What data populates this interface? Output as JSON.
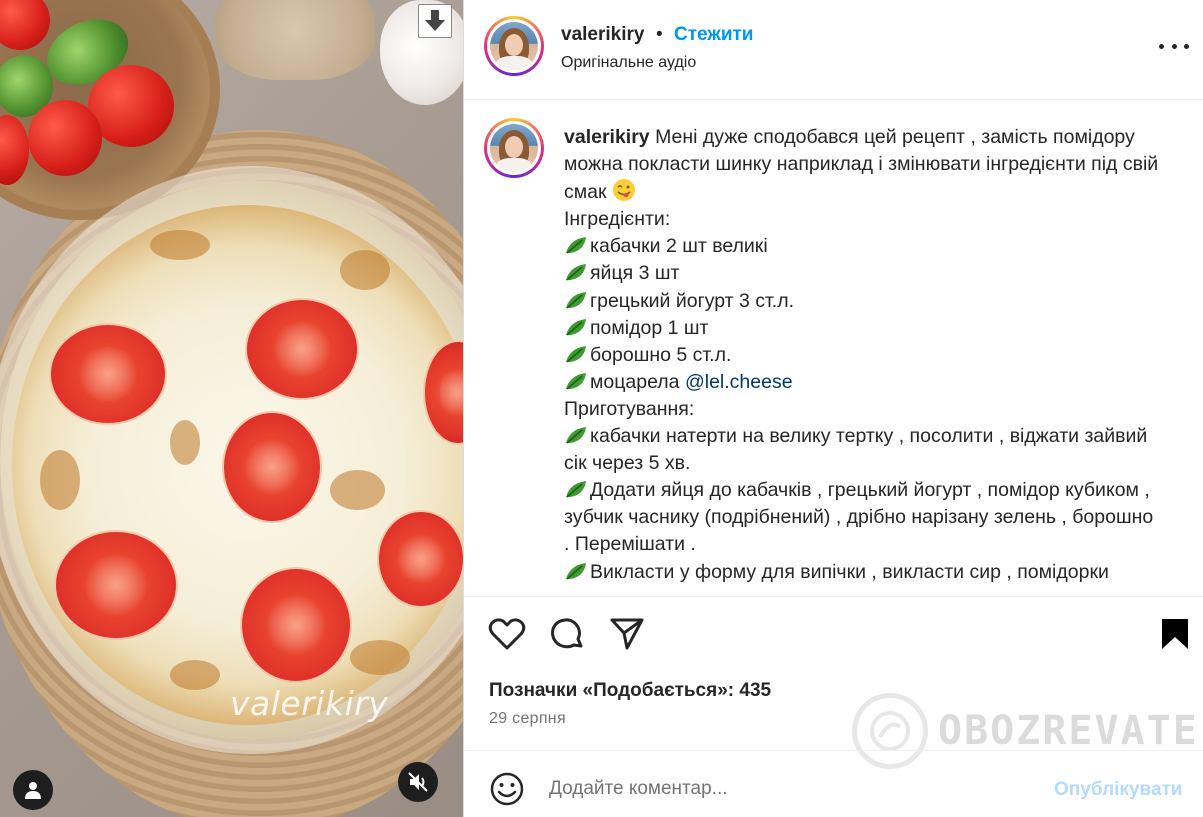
{
  "media": {
    "watermark": "valerikiry"
  },
  "header": {
    "username": "valerikiry",
    "separator": "•",
    "follow_label": "Стежити",
    "audio_label": "Оригінальне аудіо"
  },
  "caption": {
    "username": "valerikiry",
    "intro": "Мені дуже сподобався цей рецепт , замість помідору можна покласти шинку наприклад і змінювати інгредієнти під свій смак",
    "ingredients_title": "Інгредієнти:",
    "ingredients": [
      "кабачки 2 шт великі",
      "яйця 3 шт",
      "грецький йогурт 3 ст.л.",
      "помідор 1 шт",
      "борошно 5 ст.л."
    ],
    "mozzarella_label": "моцарела ",
    "mention": "@lel.cheese",
    "cooking_title": "Приготування:",
    "steps": [
      "кабачки натерти на велику тертку , посолити , віджати зайвий сік через 5 хв.",
      "Додати яйця до кабачків , грецький йогурт , помідор кубиком , зубчик часнику (подрібнений) , дрібно нарізану зелень , борошно . Перемішати .",
      "Викласти у форму для випічки , викласти сир , помідорки"
    ]
  },
  "actions": {
    "likes_text": "Позначки «Подобається»: 435",
    "date": "29 серпня"
  },
  "watermark_site": "OBOZREVATEL",
  "comment": {
    "placeholder": "Додайте коментар...",
    "publish_label": "Опублікувати"
  },
  "colors": {
    "follow_blue": "#0095f6",
    "mention_blue": "#00376b",
    "publish_disabled": "#b3dbff",
    "text_primary": "#262626",
    "text_secondary": "#737373"
  },
  "icons": [
    "download-icon",
    "more-options-icon",
    "heart-icon",
    "comment-icon",
    "share-icon",
    "bookmark-icon",
    "emoji-icon",
    "user-tag-icon",
    "mute-icon",
    "leaf-emoji-icon",
    "yummy-emoji-icon"
  ]
}
